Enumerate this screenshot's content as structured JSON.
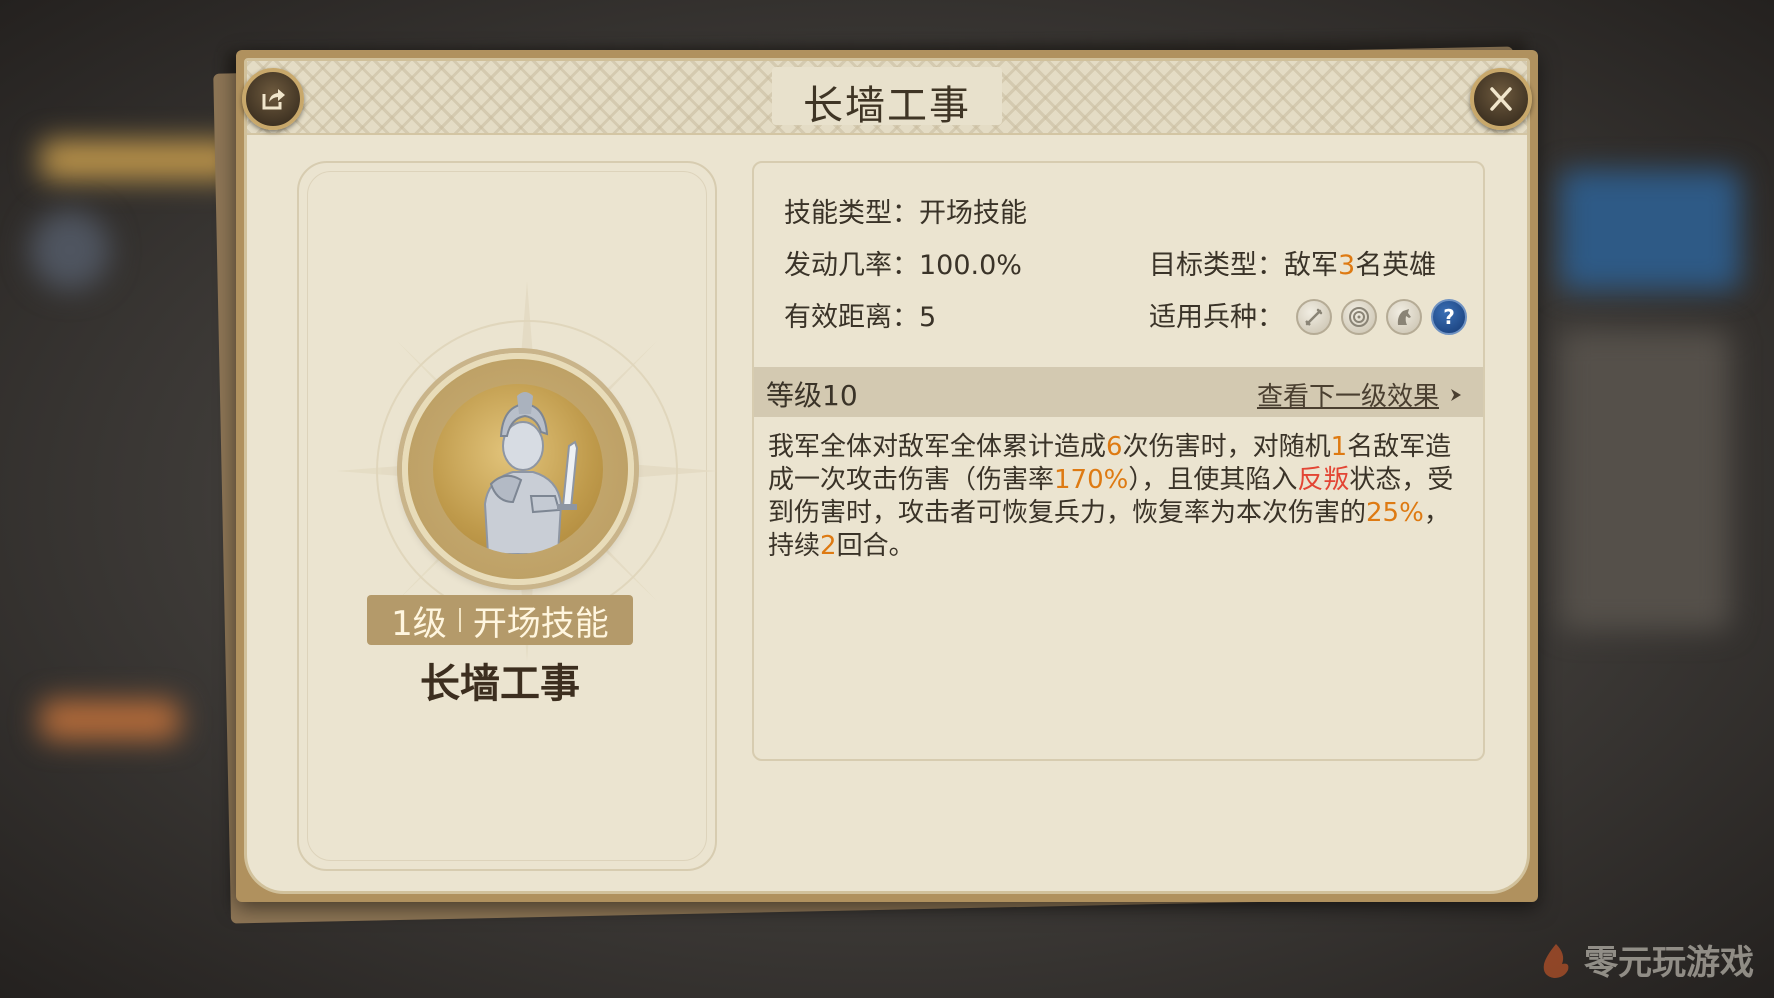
{
  "dialog": {
    "title": "长墙工事",
    "share_icon": "share-icon",
    "close_icon": "close-icon"
  },
  "left_card": {
    "level_badge": "1级",
    "skill_kind": "开场技能",
    "skill_name": "长墙工事"
  },
  "info": {
    "skill_type_label": "技能类型：",
    "skill_type_value": "开场技能",
    "trigger_rate_label": "发动几率：",
    "trigger_rate_value": "100.0%",
    "target_type_label": "目标类型：",
    "target_prefix": "敌军",
    "target_count": "3",
    "target_suffix": "名英雄",
    "range_label": "有效距离：",
    "range_value": "5",
    "troop_label": "适用兵种：",
    "troop_icons": [
      "sword-icon",
      "target-icon",
      "horse-icon",
      "question-icon"
    ]
  },
  "level_bar": {
    "level_text": "等级10",
    "next_link": "查看下一级效果"
  },
  "description": {
    "p1": "我军全体对敌军全体累计造成",
    "n1": "6",
    "p2": "次伤害时，对随机",
    "n2": "1",
    "p3": "名敌军造成一次攻击伤害（伤害率",
    "n3": "170%",
    "p4": "），且使其陷入",
    "status": "反叛",
    "p5": "状态，受到伤害时，攻击者可恢复兵力，恢复率为本次伤害的",
    "n4": "25%",
    "p6": "，持续",
    "n5": "2",
    "p7": "回合。"
  },
  "watermark": {
    "text": "零元玩游戏"
  },
  "colors": {
    "highlight_orange": "#de7a12",
    "highlight_red": "#e34534",
    "frame_gold": "#b0915e",
    "parchment": "#ebe4d0"
  }
}
